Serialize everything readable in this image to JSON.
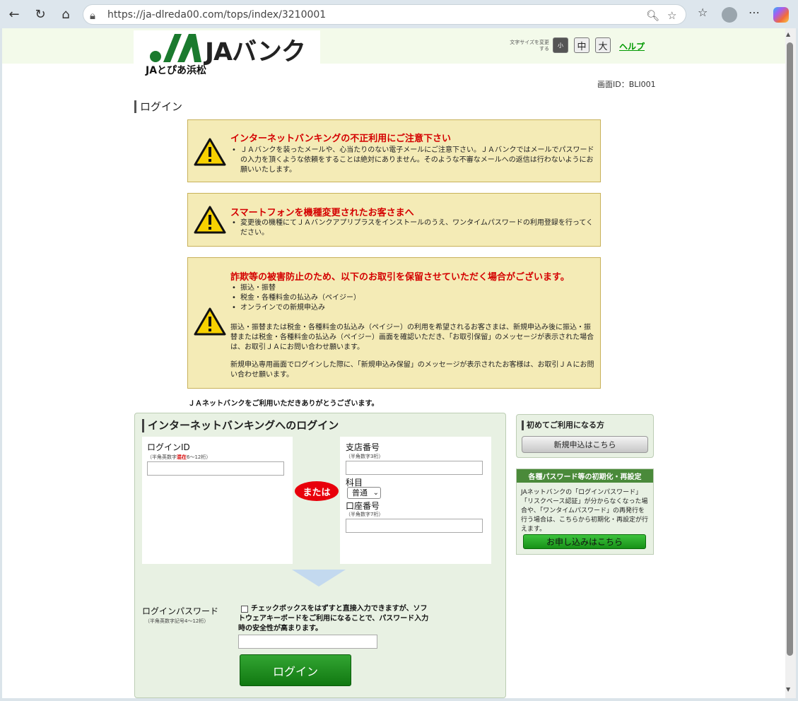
{
  "browser": {
    "url": "https://ja-dlreda00.com/tops/index/3210001",
    "nav_icons": [
      "back-icon",
      "refresh-icon",
      "home-icon"
    ],
    "toolbar_icons": [
      "zoom-icon",
      "favorite-star-icon",
      "collections-icon",
      "profile-avatar",
      "more-icon",
      "copilot-icon"
    ]
  },
  "header": {
    "logo_text": "JAバンク",
    "branch": "JAとぴあ浜松",
    "font_size_caption": "文字サイズを変更する",
    "font_size_small": "小",
    "font_size_medium": "中",
    "font_size_large": "大",
    "help": "ヘルプ"
  },
  "screen_id": "画面ID：BLI001",
  "page_title": "ログイン",
  "warnings": [
    {
      "title": "インターネットバンキングの不正利用にご注意下さい",
      "bullets": [
        "ＪＡバンクを装ったメールや、心当たりのない電子メールにご注意下さい。ＪＡバンクではメールでパスワードの入力を頂くような依頼をすることは絶対にありません。そのような不審なメールへの返信は行わないようにお願いいたします。"
      ]
    },
    {
      "title": "スマートフォンを機種変更されたお客さまへ",
      "bullets": [
        "変更後の機種にてＪＡバンクアプリプラスをインストールのうえ、ワンタイムパスワードの利用登録を行ってください。"
      ]
    },
    {
      "title": "詐欺等の被害防止のため、以下のお取引を保留させていただく場合がございます。",
      "bullets": [
        "振込・振替",
        "税金・各種料金の払込み（ペイジー）",
        "オンラインでの新規申込み"
      ],
      "para1": "振込・振替または税金・各種料金の払込み（ペイジー）の利用を希望されるお客さまは、新規申込み後に振込・振替または税金・各種料金の払込み（ペイジー）画面を確認いただき、「お取引保留」のメッセージが表示された場合は、お取引ＪＡにお問い合わせ願います。",
      "para2": "新規申込専用画面でログインした際に、「新規申込み保留」のメッセージが表示されたお客様は、お取引ＪＡにお問い合わせ願います。"
    }
  ],
  "thanks": "ＪＡネットバンクをご利用いただきありがとうございます。",
  "login": {
    "heading": "インターネットバンキングへのログイン",
    "login_id_label": "ログインID",
    "login_id_sub_pre": "（半角英数字",
    "login_id_sub_em": "混在",
    "login_id_sub_post": "6～12桁）",
    "or": "または",
    "branch_label": "支店番号",
    "branch_sub": "（半角数字3桁）",
    "subject_label": "科目",
    "subject_value": "普通",
    "account_label": "口座番号",
    "account_sub": "（半角数字7桁）",
    "password_label": "ログインパスワード",
    "password_sub": "（半角英数字記号4～12桁）",
    "checkbox_note": "チェックボックスをはずすと直接入力できますが、ソフトウェアキーボードをご利用になることで、パスワード入力時の安全性が高まります。",
    "button": "ログイン"
  },
  "first_time": {
    "title": "初めてご利用になる方",
    "button": "新規申込はこちら"
  },
  "reset": {
    "title": "各種パスワード等の初期化・再設定",
    "text": "JAネットバンクの「ログインパスワード」「リスクベース認証」が分からなくなった場合や、「ワンタイムパスワード」の再発行を行う場合は、こちらから初期化・再設定が行えます。",
    "button": "お申し込みはこちら"
  }
}
